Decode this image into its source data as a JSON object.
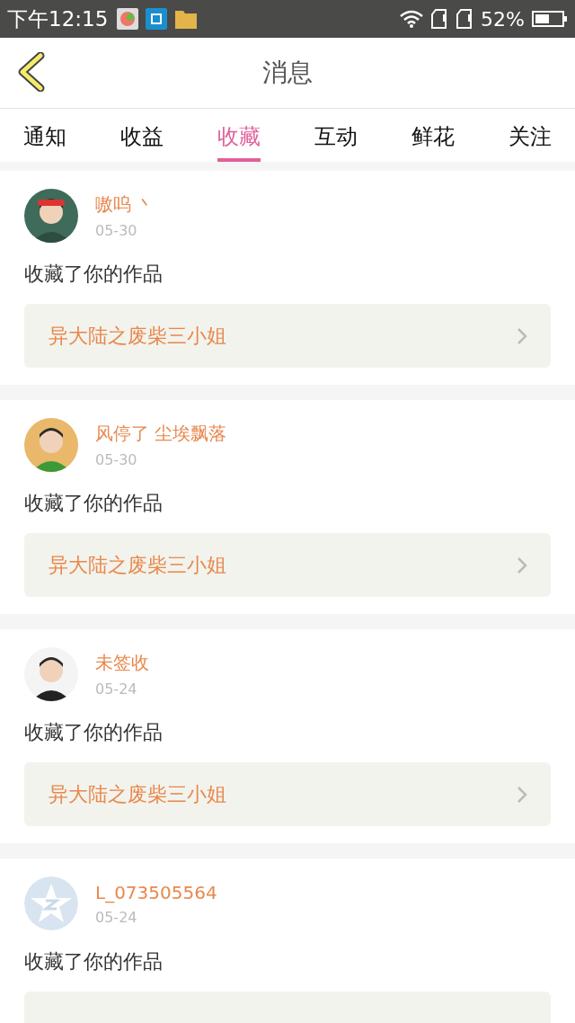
{
  "status_bar": {
    "time": "下午12:15",
    "battery": "52%"
  },
  "header": {
    "title": "消息"
  },
  "tabs": [
    {
      "label": "通知",
      "selected": false
    },
    {
      "label": "收益",
      "selected": false
    },
    {
      "label": "收藏",
      "selected": true
    },
    {
      "label": "互动",
      "selected": false
    },
    {
      "label": "鲜花",
      "selected": false
    },
    {
      "label": "关注",
      "selected": false
    }
  ],
  "messages": [
    {
      "name": "嗷呜 丶",
      "date": "05-30",
      "action": "收藏了你的作品",
      "book": "异大陆之废柴三小姐"
    },
    {
      "name": "风停了 尘埃飘落",
      "date": "05-30",
      "action": "收藏了你的作品",
      "book": "异大陆之废柴三小姐"
    },
    {
      "name": "未签收",
      "date": "05-24",
      "action": "收藏了你的作品",
      "book": "异大陆之废柴三小姐"
    },
    {
      "avatar": {
        "kind": "default"
      },
      "name": "L_073505564",
      "date": "05-24",
      "action": "收藏了你的作品"
    }
  ]
}
